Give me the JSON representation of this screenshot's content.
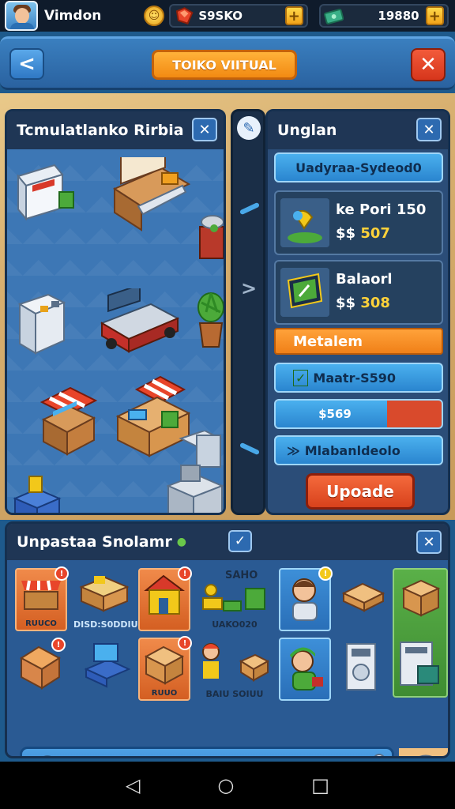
{
  "status_bar": {
    "player_name": "Vimdon",
    "coin_symbol": "☺",
    "currency_1": "S9SKO",
    "currency_2": "19880",
    "plus_label": "+"
  },
  "header": {
    "back_label": "<",
    "title": "TOIKO VIITUAL",
    "close_label": "✕"
  },
  "catalog": {
    "title": "Tcmulatlanko Rirbia",
    "close_label": "✕"
  },
  "strip": {
    "edit_icon": "✎",
    "arrow_label": ">"
  },
  "upgrade_panel": {
    "title": "Unglan",
    "close_label": "✕",
    "header_button": "Uadyraa-Sydeod0",
    "cards": [
      {
        "name": "ke Pori 150",
        "currency": "$$",
        "price": "507"
      },
      {
        "name": "Balaorl",
        "currency": "$$",
        "price": "308"
      }
    ],
    "orange_option": "Metalem",
    "option_2": "Maatr-S590",
    "option_2_icon": "✓",
    "progress": {
      "label": "$569",
      "fraction": 0.67
    },
    "option_3": "Mlabanldeolo",
    "option_3_icon": "≫",
    "upgrade_button": "Upoade"
  },
  "inventory": {
    "title": "Unpastaa Snolamr",
    "check_label": "✓",
    "close_label": "✕",
    "slots": [
      {
        "label": "RUUCO",
        "badge": "!"
      },
      {
        "label": "DISD:S0DDIU",
        "badge": ""
      },
      {
        "label": "",
        "badge": "!"
      },
      {
        "label": "UAKO020",
        "badge": "",
        "top_label": "SAHO"
      },
      {
        "label": "",
        "badge": "!"
      },
      {
        "label": "",
        "badge": ""
      },
      {
        "label": "",
        "badge": "!"
      },
      {
        "label": "",
        "badge": ""
      },
      {
        "label": "RUUO",
        "badge": "!"
      },
      {
        "label": "BAIU SOIUU",
        "badge": ""
      },
      {
        "label": "",
        "badge": ""
      },
      {
        "label": "",
        "badge": ""
      }
    ]
  },
  "navbar": {
    "back_icon": "◁",
    "home_icon": "○",
    "recents_icon": "□"
  }
}
